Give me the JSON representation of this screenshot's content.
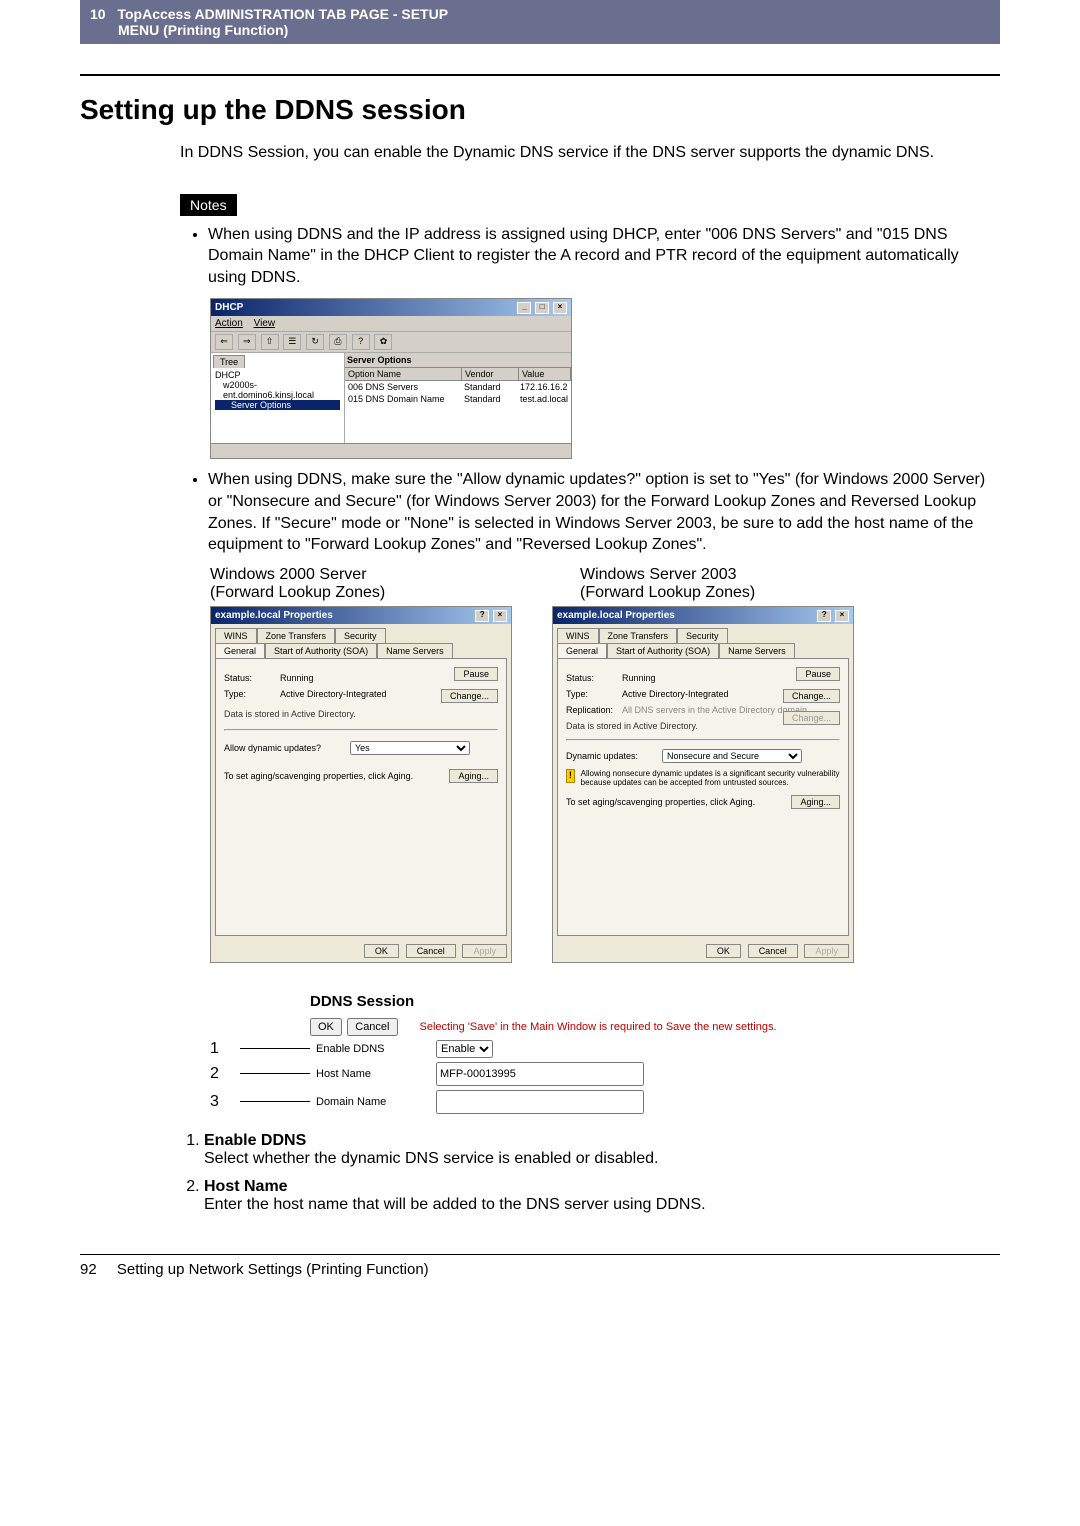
{
  "header": {
    "chapter_num": "10",
    "chapter_title": "TopAccess ADMINISTRATION TAB PAGE - SETUP",
    "chapter_sub": "MENU (Printing Function)"
  },
  "h1": "Setting up the DDNS session",
  "intro": "In DDNS Session, you can enable the Dynamic DNS service if the DNS server supports the dynamic DNS.",
  "notes_label": "Notes",
  "notes": {
    "item1": "When using DDNS and the IP address is assigned using DHCP, enter \"006 DNS Servers\" and \"015 DNS Domain Name\" in the DHCP Client to register the A record and PTR record of the equipment automatically using DDNS.",
    "item2": "When using DDNS, make sure the \"Allow dynamic updates?\" option is set to \"Yes\" (for Windows 2000 Server) or \"Nonsecure and Secure\" (for Windows Server 2003) for the Forward Lookup Zones and Reversed Lookup Zones. If \"Secure\" mode or \"None\" is selected in Windows Server 2003, be sure to add the host name of the equipment to \"Forward Lookup Zones\" and \"Reversed Lookup Zones\"."
  },
  "dhcp": {
    "title": "DHCP",
    "menu_action": "Action",
    "menu_view": "View",
    "tree_tab": "Tree",
    "tree_root": "DHCP",
    "tree_node": "w2000s-ent.domino6.kinsj.local",
    "tree_selected": "Server Options",
    "list_header_title": "Server Options",
    "col_opt": "Option Name",
    "col_vendor": "Vendor",
    "col_value": "Value",
    "row1_name": "006 DNS Servers",
    "row1_vendor": "Standard",
    "row1_value": "172.16.16.2",
    "row2_name": "015 DNS Domain Name",
    "row2_vendor": "Standard",
    "row2_value": "test.ad.local"
  },
  "captions": {
    "c1a": "Windows 2000 Server",
    "c1b": "(Forward Lookup Zones)",
    "c2a": "Windows Server 2003",
    "c2b": "(Forward Lookup Zones)"
  },
  "props": {
    "title": "example.local Properties",
    "tab_wins": "WINS",
    "tab_zone": "Zone Transfers",
    "tab_security": "Security",
    "tab_general": "General",
    "tab_soa": "Start of Authority (SOA)",
    "tab_ns": "Name Servers",
    "status_lbl": "Status:",
    "status_val": "Running",
    "pause_btn": "Pause",
    "type_lbl": "Type:",
    "type_val": "Active Directory-Integrated",
    "change_btn": "Change...",
    "repl_lbl": "Replication:",
    "repl_val": "All DNS servers in the Active Directory domain",
    "stored": "Data is stored in Active Directory.",
    "allow_lbl": "Allow dynamic updates?",
    "allow_val": "Yes",
    "dyn_lbl": "Dynamic updates:",
    "dyn_val": "Nonsecure and Secure",
    "warn": "Allowing nonsecure dynamic updates is a significant security vulnerability because updates can be accepted from untrusted sources.",
    "aging_text": "To set aging/scavenging properties, click Aging.",
    "aging_btn": "Aging...",
    "ok": "OK",
    "cancel": "Cancel",
    "apply": "Apply"
  },
  "ddns": {
    "title": "DDNS Session",
    "ok": "OK",
    "cancel": "Cancel",
    "hint": "Selecting 'Save' in the Main Window is required to Save the new settings.",
    "enable_lbl": "Enable DDNS",
    "enable_val": "Enable",
    "host_lbl": "Host Name",
    "host_val": "MFP-00013995",
    "domain_lbl": "Domain Name",
    "domain_val": ""
  },
  "callouts": {
    "n1": "1",
    "n2": "2",
    "n3": "3"
  },
  "fields": {
    "f1_name": "Enable DDNS",
    "f1_desc": "Select whether the dynamic DNS service is enabled or disabled.",
    "f2_name": "Host Name",
    "f2_desc": "Enter the host name that will be added to the DNS server using DDNS."
  },
  "footer": {
    "page_num": "92",
    "footer_text": "Setting up Network Settings (Printing Function)"
  }
}
